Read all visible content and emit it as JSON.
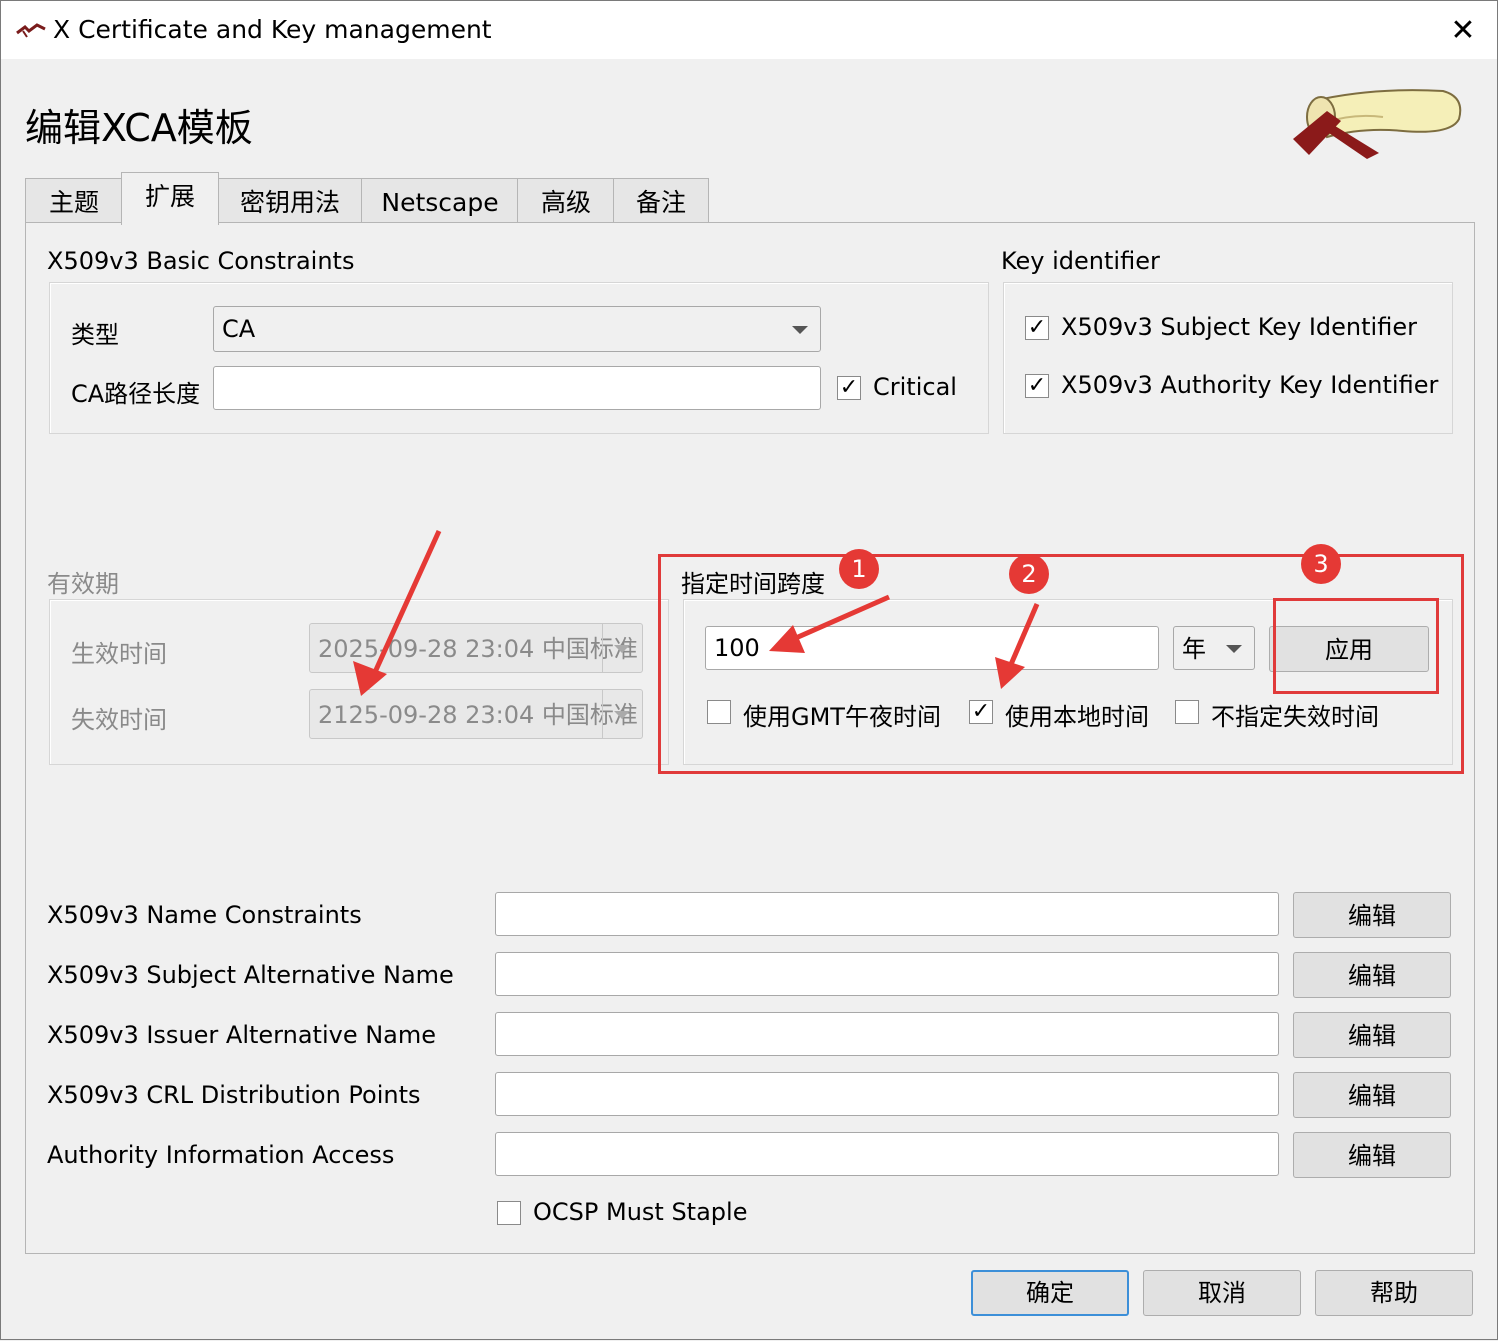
{
  "window": {
    "title": "X Certificate and Key management",
    "close_glyph": "✕"
  },
  "heading": "编辑XCA模板",
  "tabs": [
    "主题",
    "扩展",
    "密钥用法",
    "Netscape",
    "高级",
    "备注"
  ],
  "basic_constraints": {
    "title": "X509v3 Basic Constraints",
    "type_label": "类型",
    "type_value": "CA",
    "path_len_label": "CA路径长度",
    "path_len_value": "",
    "critical_label": "Critical",
    "critical_check": "✓"
  },
  "key_identifier": {
    "title": "Key identifier",
    "subject_label": "X509v3 Subject Key Identifier",
    "authority_label": "X509v3 Authority Key Identifier",
    "check": "✓"
  },
  "validity": {
    "title": "有效期",
    "start_label": "生效时间",
    "start_value": "2025-09-28 23:04 中国标准",
    "end_label": "失效时间",
    "end_value": "2125-09-28 23:04 中国标准"
  },
  "timespan": {
    "title": "指定时间跨度",
    "amount": "100",
    "unit": "年",
    "apply_label": "应用",
    "gmt_label": "使用GMT午夜时间",
    "local_label": "使用本地时间",
    "local_check": "✓",
    "no_expiry_label": "不指定失效时间"
  },
  "annotations": [
    "1",
    "2",
    "3"
  ],
  "extensions": [
    {
      "label": "X509v3 Name Constraints",
      "value": "",
      "button": "编辑"
    },
    {
      "label": "X509v3 Subject Alternative Name",
      "value": "",
      "button": "编辑"
    },
    {
      "label": "X509v3 Issuer Alternative Name",
      "value": "",
      "button": "编辑"
    },
    {
      "label": "X509v3 CRL Distribution Points",
      "value": "",
      "button": "编辑"
    },
    {
      "label": "Authority Information Access",
      "value": "",
      "button": "编辑"
    }
  ],
  "ocsp_label": "OCSP Must Staple",
  "buttons": {
    "ok": "确定",
    "cancel": "取消",
    "help": "帮助"
  },
  "colors": {
    "annotation_red": "#e53935",
    "default_button_border": "#3c8fd8"
  }
}
